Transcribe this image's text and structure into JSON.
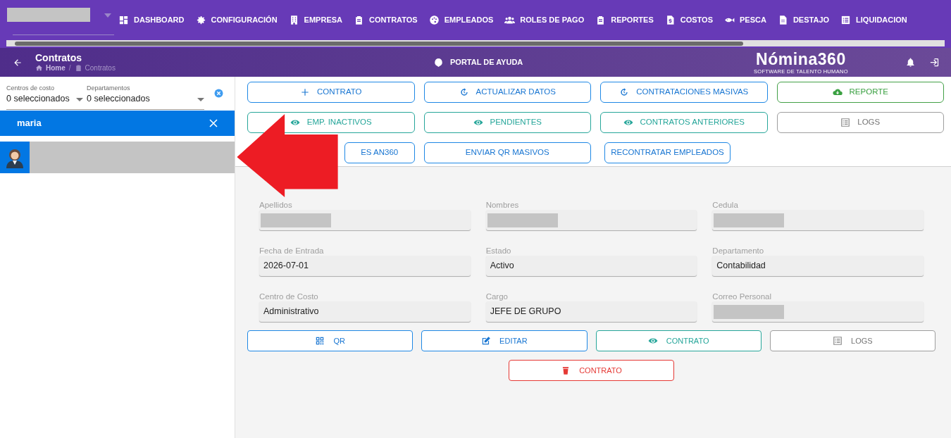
{
  "nav": [
    {
      "label": "DASHBOARD"
    },
    {
      "label": "CONFIGURACIÓN"
    },
    {
      "label": "EMPRESA"
    },
    {
      "label": "CONTRATOS"
    },
    {
      "label": "EMPLEADOS"
    },
    {
      "label": "ROLES DE PAGO"
    },
    {
      "label": "REPORTES"
    },
    {
      "label": "COSTOS"
    },
    {
      "label": "PESCA"
    },
    {
      "label": "DESTAJO"
    },
    {
      "label": "LIQUIDACION"
    }
  ],
  "header": {
    "title": "Contratos",
    "breadcrumb": [
      "Home",
      "/",
      "Contratos"
    ],
    "help": "PORTAL DE AYUDA",
    "logo": "Nómina360",
    "logo_tagline": "SOFTWARE DE TALENTO HUMANO"
  },
  "filters": [
    {
      "label": "Centros de costo",
      "value": "0 seleccionados"
    },
    {
      "label": "Departamentos",
      "value": "0 seleccionados"
    }
  ],
  "search": {
    "value": "maria"
  },
  "employees": [
    {
      "selected": true
    }
  ],
  "actions": [
    {
      "label": "CONTRATO",
      "kind": "blue"
    },
    {
      "label": "ACTUALIZAR DATOS",
      "kind": "blue"
    },
    {
      "label": "CONTRATACIONES MASIVAS",
      "kind": "blue"
    },
    {
      "label": "REPORTE",
      "kind": "green"
    },
    {
      "label": "EMP. INACTIVOS",
      "kind": "teal"
    },
    {
      "label": "PENDIENTES",
      "kind": "teal"
    },
    {
      "label": "CONTRATOS ANTERIORES",
      "kind": "teal"
    },
    {
      "label": "LOGS",
      "kind": "gray"
    },
    {
      "label": "ES AN360",
      "kind": "blue"
    },
    {
      "label": "ENVIAR QR MASIVOS",
      "kind": "blue"
    },
    {
      "label": "RECONTRATAR EMPLEADOS",
      "kind": "blue"
    }
  ],
  "fields": [
    {
      "label": "Apellidos",
      "redacted": true
    },
    {
      "label": "Nombres",
      "redacted": true
    },
    {
      "label": "Cedula",
      "redacted": true
    },
    {
      "label": "Fecha de Entrada",
      "value": "2026-07-01"
    },
    {
      "label": "Estado",
      "value": "Activo"
    },
    {
      "label": "Departamento",
      "value": "Contabilidad"
    },
    {
      "label": "Centro de Costo",
      "value": "Administrativo"
    },
    {
      "label": "Cargo",
      "value": "JEFE DE GRUPO"
    },
    {
      "label": "Correo Personal",
      "redacted": true
    }
  ],
  "detail_actions": [
    {
      "label": "QR",
      "kind": "blue"
    },
    {
      "label": "EDITAR",
      "kind": "blue"
    },
    {
      "label": "CONTRATO",
      "kind": "teal"
    },
    {
      "label": "LOGS",
      "kind": "gray"
    },
    {
      "label": "CONTRATO",
      "kind": "red"
    }
  ]
}
